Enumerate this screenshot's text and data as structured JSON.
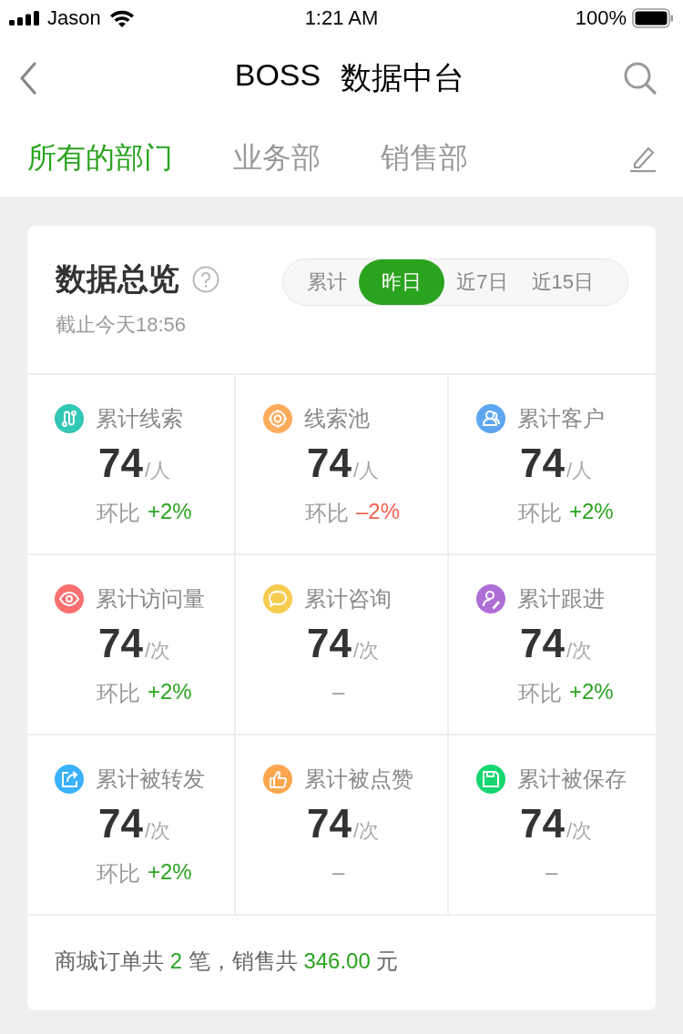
{
  "status_bar": {
    "carrier": "Jason",
    "time": "1:21 AM",
    "battery": "100%"
  },
  "nav": {
    "title_latin": "BOSS",
    "title_cjk": "数据中台"
  },
  "dept_tabs": [
    {
      "label": "所有的部门",
      "selected": true
    },
    {
      "label": "业务部",
      "selected": false
    },
    {
      "label": "销售部",
      "selected": false
    }
  ],
  "overview": {
    "title": "数据总览",
    "subtitle": "截止今天18:56",
    "periods": [
      {
        "label": "累计",
        "selected": false
      },
      {
        "label": "昨日",
        "selected": true
      },
      {
        "label": "近7日",
        "selected": false
      },
      {
        "label": "近15日",
        "selected": false
      }
    ],
    "metrics": [
      {
        "label": "累计线索",
        "color": "#33c7b5",
        "value": "74",
        "unit": "/人",
        "kind": "up",
        "change_label": "环比",
        "change": "+2%"
      },
      {
        "label": "线索池",
        "color": "#fdac5c",
        "value": "74",
        "unit": "/人",
        "kind": "down",
        "change_label": "环比",
        "change": "–2%"
      },
      {
        "label": "累计客户",
        "color": "#5ea6ef",
        "value": "74",
        "unit": "/人",
        "kind": "up",
        "change_label": "环比",
        "change": "+2%"
      },
      {
        "label": "累计访问量",
        "color": "#fb6f6f",
        "value": "74",
        "unit": "/次",
        "kind": "up",
        "change_label": "环比",
        "change": "+2%"
      },
      {
        "label": "累计咨询",
        "color": "#f6cc4e",
        "value": "74",
        "unit": "/次",
        "kind": "none",
        "change": "–"
      },
      {
        "label": "累计跟进",
        "color": "#ae6ed6",
        "value": "74",
        "unit": "/次",
        "kind": "up",
        "change_label": "环比",
        "change": "+2%"
      },
      {
        "label": "累计被转发",
        "color": "#3ab1fb",
        "value": "74",
        "unit": "/次",
        "kind": "up",
        "change_label": "环比",
        "change": "+2%"
      },
      {
        "label": "累计被点赞",
        "color": "#fda64d",
        "value": "74",
        "unit": "/次",
        "kind": "none",
        "change": "–"
      },
      {
        "label": "累计被保存",
        "color": "#16d66f",
        "value": "74",
        "unit": "/次",
        "kind": "none",
        "change": "–"
      }
    ],
    "summary": [
      {
        "text": "商城订单共 ",
        "highlight": false
      },
      {
        "text": "2",
        "highlight": true
      },
      {
        "text": " 笔，销售共 ",
        "highlight": false
      },
      {
        "text": "346.00",
        "highlight": true
      },
      {
        "text": " 元",
        "highlight": false
      }
    ]
  }
}
